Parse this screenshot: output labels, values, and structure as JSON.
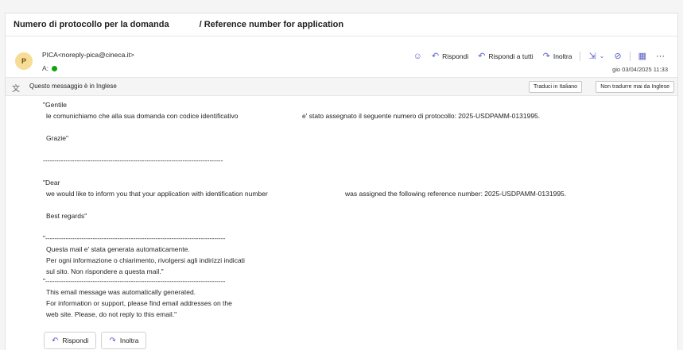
{
  "subject": {
    "left": "Numero di protocollo per la domanda",
    "right": "/ Reference number for application"
  },
  "sender": {
    "initial": "P",
    "name": "PICA<noreply-pica@cineca.it>"
  },
  "recipient": {
    "label": "A:"
  },
  "actions": {
    "reply": "Rispondi",
    "reply_all": "Rispondi a tutti",
    "forward": "Inoltra"
  },
  "date": "gio 03/04/2025 11:33",
  "translation": {
    "message": "Questo messaggio è in Inglese",
    "translate_btn": "Traduci in Italiano",
    "never_btn": "Non tradurre mai da Inglese"
  },
  "body": {
    "it_greeting": "\"Gentile",
    "it_line1a": "le comunichiamo che alla sua domanda con codice identificativo",
    "it_line1b": "e' stato assegnato il seguente numero di protocollo: 2025-USDPAMM-0131995.",
    "it_thanks": "Grazie\"",
    "divider1": "--------------------------------------------------------------------------------",
    "en_greeting": "\"Dear",
    "en_line1a": "we would like to inform you that your application with identification number",
    "en_line1b": "was assigned the following reference number: 2025-USDPAMM-0131995.",
    "en_regards": "Best regards\"",
    "divider2": "\"--------------------------------------------------------------------------------",
    "it_auto1": "Questa mail e' stata generata automaticamente.",
    "it_auto2": "Per ogni informazione o chiarimento, rivolgersi agli indirizzi indicati",
    "it_auto3": "sul sito. Non rispondere a questa mail.\"",
    "divider3": "\"--------------------------------------------------------------------------------",
    "en_auto1": "This email message was automatically generated.",
    "en_auto2": "For information or support, please find email addresses on the",
    "en_auto3": "web site. Please, do not reply to this email.\""
  },
  "bottom": {
    "reply": "Rispondi",
    "forward": "Inoltra"
  },
  "colors": {
    "accent": "#5b5fc7",
    "avatar_bg": "#f7dc95",
    "status_green": "#13a10e"
  }
}
